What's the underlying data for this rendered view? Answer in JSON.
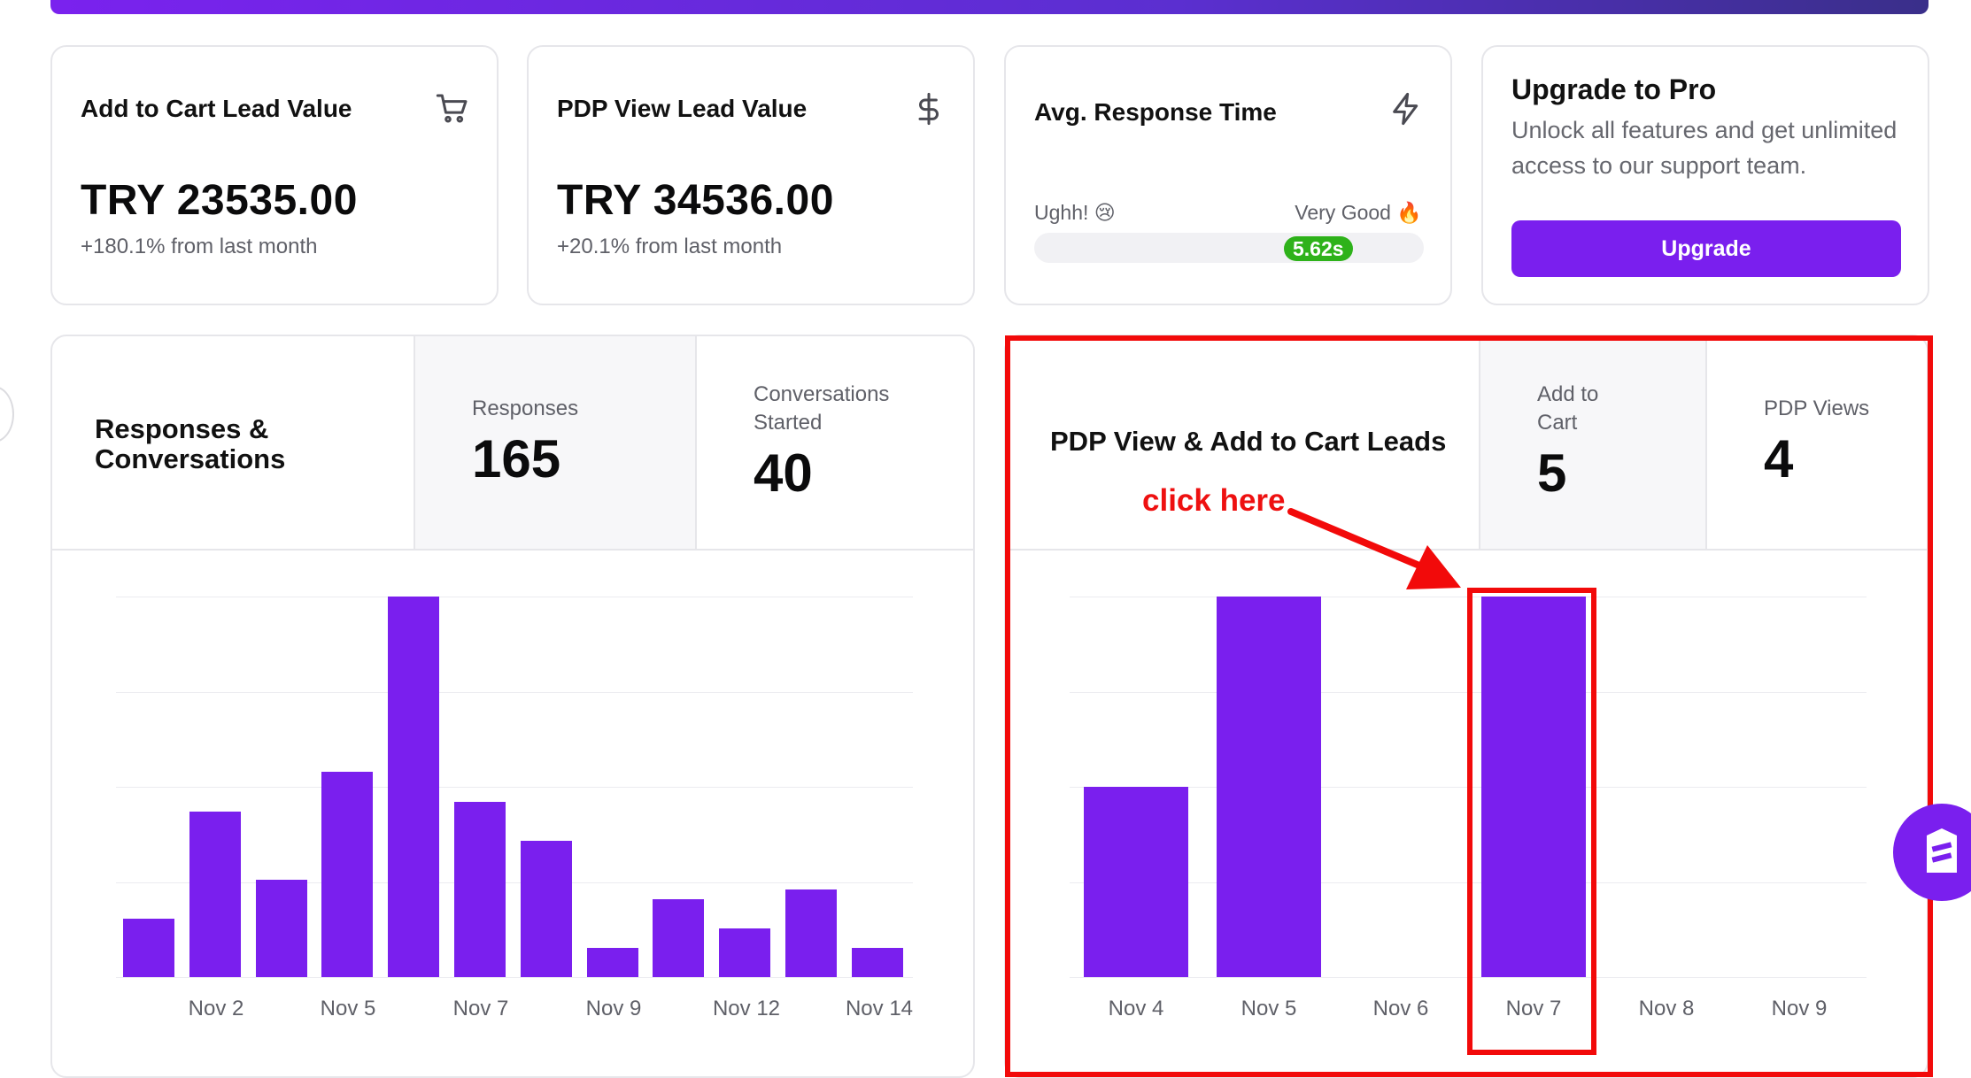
{
  "cards": {
    "add_to_cart": {
      "title": "Add to Cart Lead Value",
      "value": "TRY 23535.00",
      "sub": "+180.1% from last month",
      "icon": "cart-icon"
    },
    "pdp_view": {
      "title": "PDP View Lead Value",
      "value": "TRY 34536.00",
      "sub": "+20.1% from last month",
      "icon": "dollar-icon"
    },
    "response_time": {
      "title": "Avg. Response Time",
      "left_label": "Ughh! 😢",
      "right_label": "Very Good 🔥",
      "value": "5.62s",
      "icon": "lightning-icon"
    },
    "upgrade": {
      "title": "Upgrade to Pro",
      "desc": "Unlock all features and get unlimited access to our support team.",
      "button": "Upgrade"
    }
  },
  "responses_panel": {
    "title_line1": "Responses &",
    "title_line2": "Conversations",
    "metric1": {
      "label": "Responses",
      "value": "165"
    },
    "metric2": {
      "label_line1": "Conversations",
      "label_line2": "Started",
      "value": "40"
    }
  },
  "leads_panel": {
    "title": "PDP View & Add to Cart Leads",
    "metric1": {
      "label_line1": "Add to",
      "label_line2": "Cart",
      "value": "5"
    },
    "metric2": {
      "label": "PDP Views",
      "value": "4"
    }
  },
  "annotation": {
    "text": "click here"
  },
  "colors": {
    "accent": "#7a1fee",
    "annotation": "#f20a0a",
    "badge": "#2eb21a"
  },
  "chart_data": [
    {
      "type": "bar",
      "title": "",
      "ylim": [
        0,
        3.9
      ],
      "values": [
        0.6,
        1.7,
        1.0,
        2.1,
        3.9,
        1.8,
        1.4,
        0.3,
        0.8,
        0.5,
        0.9,
        0.3
      ],
      "tick_labels": [
        "Nov 2",
        "Nov 5",
        "Nov 7",
        "Nov 9",
        "Nov 12",
        "Nov 14"
      ]
    },
    {
      "type": "bar",
      "title": "",
      "ylim": [
        0,
        4
      ],
      "categories": [
        "Nov 4",
        "Nov 5",
        "Nov 6",
        "Nov 7",
        "Nov 8",
        "Nov 9"
      ],
      "values": [
        2,
        4,
        0,
        4,
        0,
        0
      ]
    }
  ]
}
